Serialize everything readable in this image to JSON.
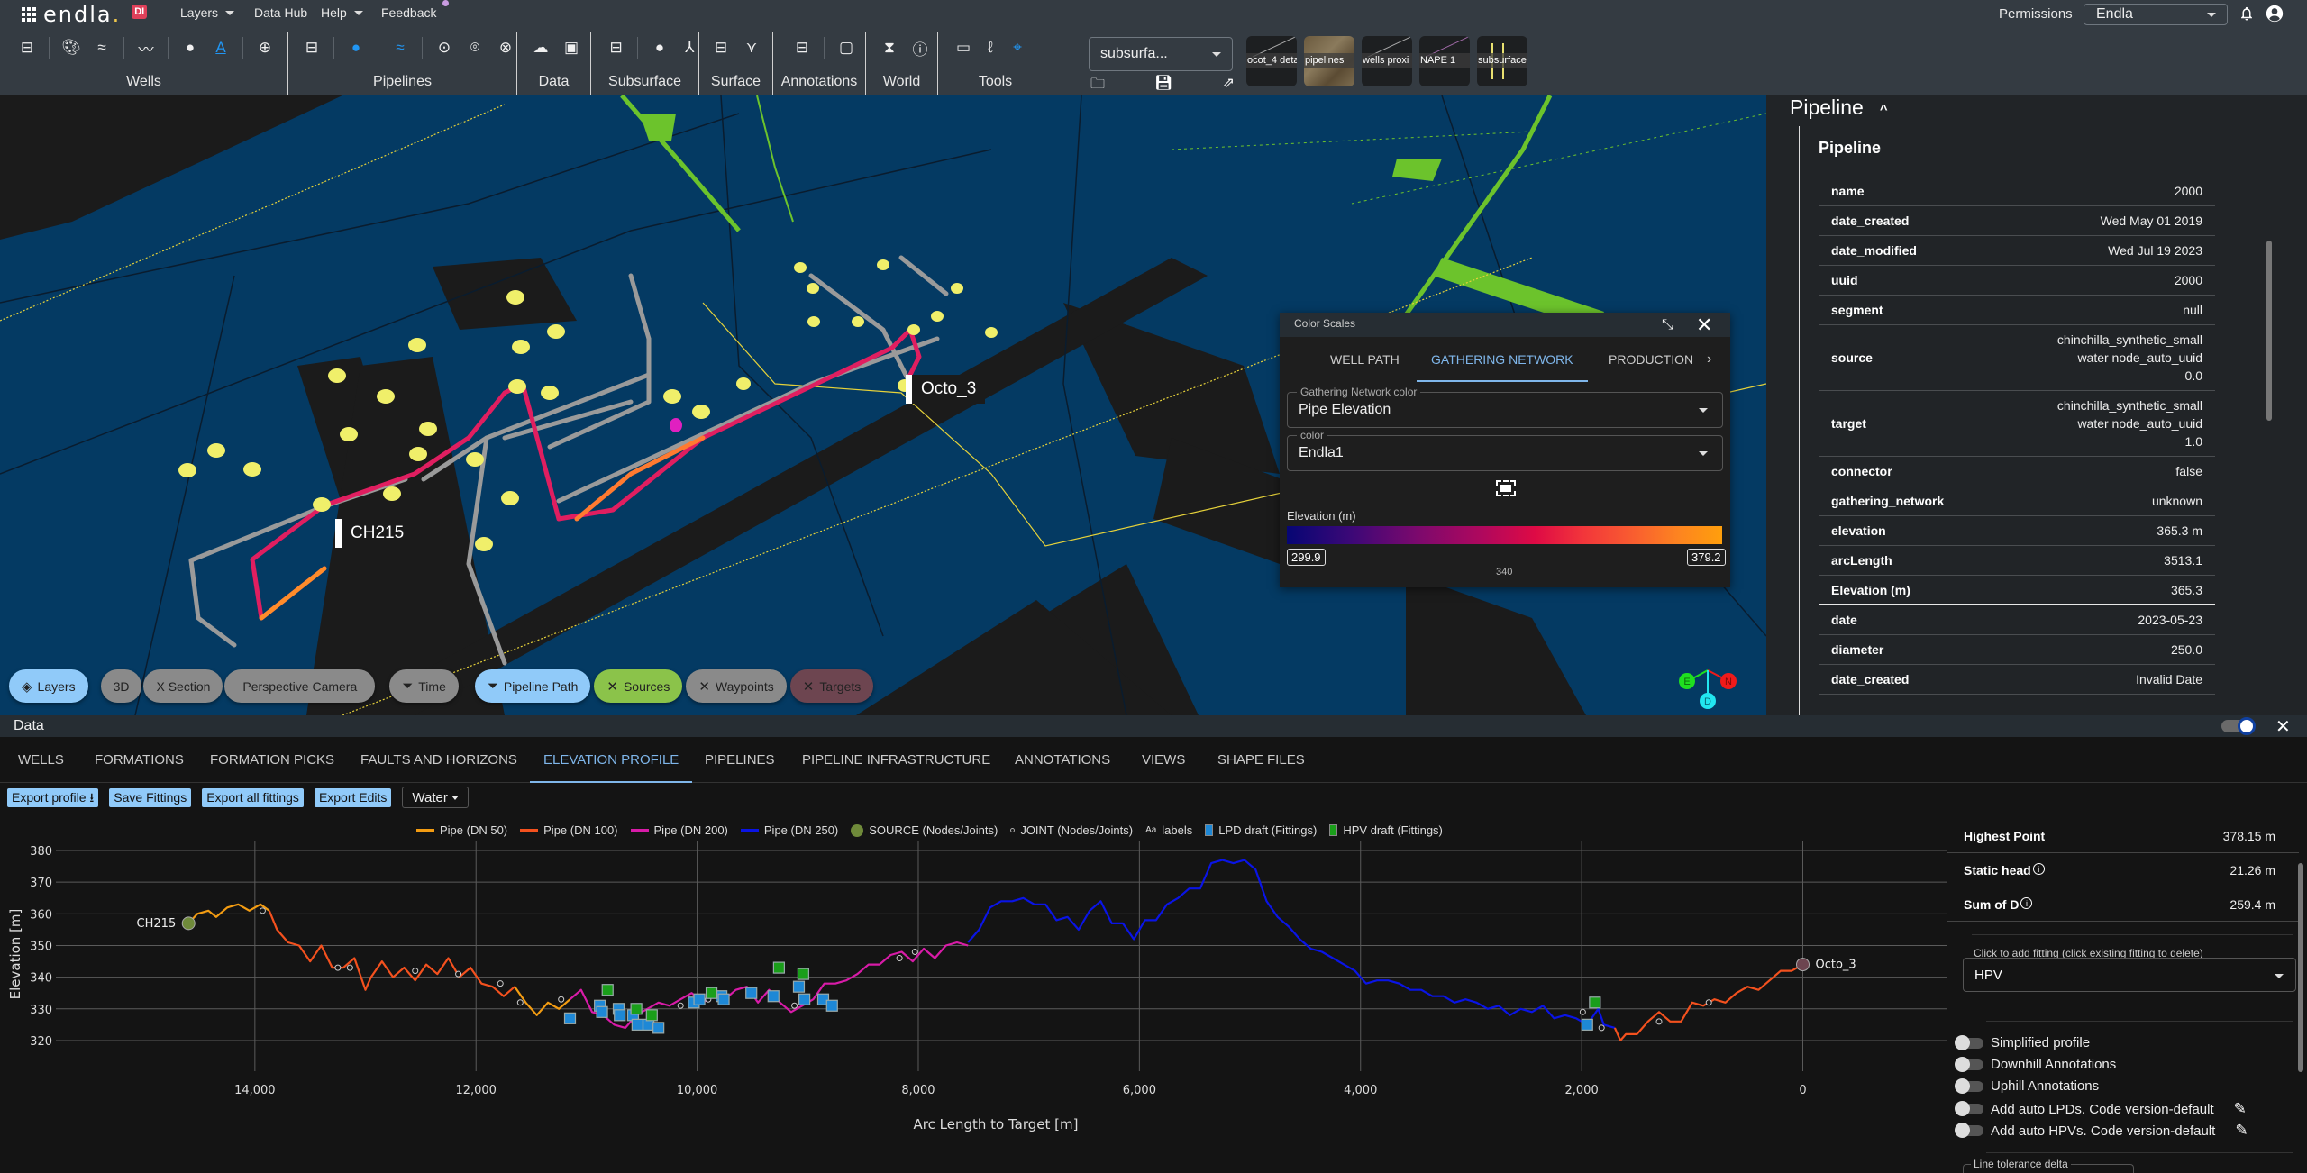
{
  "app": {
    "brand": "endla",
    "brand_dot": ".",
    "badge": "DI",
    "menu": [
      {
        "label": "Layers",
        "has_caret": true
      },
      {
        "label": "Data Hub",
        "has_caret": false
      },
      {
        "label": "Help",
        "has_caret": true
      },
      {
        "label": "Feedback",
        "has_caret": false
      }
    ],
    "permissions_label": "Permissions",
    "org_select": "Endla",
    "icons": {
      "notifications": "bell-icon",
      "account": "account-circle-icon",
      "apps": "apps-grid-icon"
    }
  },
  "toolbar": {
    "groups": [
      {
        "label": "Wells",
        "icons": [
          "layout-panel-icon",
          "palette-icon",
          "double-chevron-icon",
          "trend-line-icon",
          "bubbles-icon",
          "text-color-icon",
          "add-circle-icon"
        ]
      },
      {
        "label": "Pipelines",
        "icons": [
          "layout-panel-icon",
          "palette-icon",
          "double-chevron-icon",
          "target-icon",
          "add-location-icon",
          "cancel-circle-icon"
        ]
      },
      {
        "label": "Data",
        "icons": [
          "cloud-upload-icon",
          "database-icon"
        ]
      },
      {
        "label": "Subsurface",
        "icons": [
          "layout-panel-icon",
          "palette-icon",
          "fork-icon"
        ]
      },
      {
        "label": "Surface",
        "icons": [
          "layout-panel-icon",
          "grass-icon"
        ]
      },
      {
        "label": "Annotations",
        "icons": [
          "layout-panel-icon",
          "comment-icon"
        ]
      },
      {
        "label": "World",
        "icons": [
          "hourglass-icon",
          "info-icon"
        ]
      },
      {
        "label": "Tools",
        "icons": [
          "ruler-icon",
          "lasso-icon",
          "crosshair-icon"
        ]
      }
    ],
    "view_select": "subsurfa...",
    "view_actions": [
      "folder-icon",
      "save-icon",
      "share-icon"
    ],
    "saved_views": [
      "ocot_4 deta",
      "pipelines",
      "wells proxi",
      "NAPE 1",
      "subsurface"
    ]
  },
  "viewport": {
    "labels": [
      {
        "text": "CH215",
        "color": "#8bc34a"
      },
      {
        "text": "Octo_3",
        "color": "#6d4550"
      }
    ],
    "chips": [
      {
        "label": "Layers",
        "icon": "layers-icon",
        "style": "blue"
      },
      {
        "label": "3D",
        "icon": "",
        "style": "grey"
      },
      {
        "label": "X Section",
        "icon": "",
        "style": "grey"
      },
      {
        "label": "Perspective Camera",
        "icon": "",
        "style": "grey"
      },
      {
        "label": "Time",
        "icon": "filter-icon",
        "style": "grey"
      },
      {
        "label": "Pipeline Path",
        "icon": "filter-icon",
        "style": "blue"
      },
      {
        "label": "Sources",
        "icon": "close-icon",
        "style": "green"
      },
      {
        "label": "Waypoints",
        "icon": "close-icon",
        "style": "grey"
      },
      {
        "label": "Targets",
        "icon": "close-icon",
        "style": "red"
      }
    ],
    "compass": {
      "east": "E",
      "north": "N",
      "down": "D"
    }
  },
  "color_scales": {
    "title": "Color Scales",
    "tabs": [
      "WELL PATH",
      "GATHERING NETWORK",
      "PRODUCTION"
    ],
    "active_tab": 1,
    "network_color_label": "Gathering Network color",
    "network_color_value": "Pipe Elevation",
    "color_label": "color",
    "color_value": "Endla1",
    "legend_title": "Elevation (m)",
    "min": "299.9",
    "max": "379.2",
    "mid_tick": "340"
  },
  "properties": {
    "section_title": "Pipeline",
    "sub_title": "Pipeline",
    "rows": [
      {
        "key": "name",
        "value": [
          "2000"
        ]
      },
      {
        "key": "date_created",
        "value": [
          "Wed May 01 2019"
        ]
      },
      {
        "key": "date_modified",
        "value": [
          "Wed Jul 19 2023"
        ]
      },
      {
        "key": "uuid",
        "value": [
          "2000"
        ]
      },
      {
        "key": "segment",
        "value": [
          "null"
        ]
      },
      {
        "key": "source",
        "value": [
          "chinchilla_synthetic_small",
          "water node_auto_uuid",
          "0.0"
        ]
      },
      {
        "key": "target",
        "value": [
          "chinchilla_synthetic_small",
          "water node_auto_uuid",
          "1.0"
        ]
      },
      {
        "key": "connector",
        "value": [
          "false"
        ]
      },
      {
        "key": "gathering_network",
        "value": [
          "unknown"
        ]
      },
      {
        "key": "elevation",
        "value": [
          "365.3 m"
        ]
      },
      {
        "key": "arcLength",
        "value": [
          "3513.1"
        ]
      },
      {
        "key": "Elevation (m)",
        "value": [
          "365.3"
        ]
      },
      {
        "key": "date",
        "value": [
          "2023-05-23"
        ]
      },
      {
        "key": "diameter",
        "value": [
          "250.0"
        ]
      },
      {
        "key": "date_created",
        "value": [
          "Invalid Date"
        ]
      }
    ]
  },
  "data_panel": {
    "title": "Data",
    "tabs": [
      "WELLS",
      "FORMATIONS",
      "FORMATION PICKS",
      "FAULTS AND HORIZONS",
      "ELEVATION PROFILE",
      "PIPELINES",
      "PIPELINE INFRASTRUCTURE",
      "ANNOTATIONS",
      "VIEWS",
      "SHAPE FILES"
    ],
    "active_tab": 4,
    "buttons": {
      "export_profile": "Export profile",
      "save_fittings": "Save Fittings",
      "export_all": "Export all fittings",
      "export_edits": "Export Edits"
    },
    "fluid_select": "Water",
    "legend": [
      {
        "label": "Pipe (DN 50)",
        "type": "line",
        "color": "#f39c12"
      },
      {
        "label": "Pipe (DN 100)",
        "type": "line",
        "color": "#f4511e"
      },
      {
        "label": "Pipe (DN 200)",
        "type": "line",
        "color": "#d81ba8"
      },
      {
        "label": "Pipe (DN 250)",
        "type": "line",
        "color": "#0a14e6"
      },
      {
        "label": "SOURCE (Nodes/Joints)",
        "type": "circle",
        "color": "#6f8a3a"
      },
      {
        "label": "JOINT (Nodes/Joints)",
        "type": "small-circle",
        "color": "#aaaaaa"
      },
      {
        "label": "labels",
        "type": "text",
        "color": "#dddddd"
      },
      {
        "label": "LPD draft (Fittings)",
        "type": "square",
        "color": "#1e88d6"
      },
      {
        "label": "HPV draft (Fittings)",
        "type": "square",
        "color": "#1a9e1a"
      }
    ],
    "stats": [
      {
        "key": "Highest Point",
        "value": "378.15 m",
        "info": false
      },
      {
        "key": "Static head",
        "value": "21.26 m",
        "info": true
      },
      {
        "key": "Sum of D",
        "value": "259.4 m",
        "info": true
      }
    ],
    "fitting_hint": "Click to add fitting (click existing fitting to delete)",
    "fitting_select": "HPV",
    "toggles": [
      {
        "label": "Simplified profile",
        "on": false,
        "editable": false
      },
      {
        "label": "Downhill Annotations",
        "on": false,
        "editable": false
      },
      {
        "label": "Uphill Annotations",
        "on": false,
        "editable": false
      },
      {
        "label": "Add auto LPDs. Code version-default",
        "on": false,
        "editable": true
      },
      {
        "label": "Add auto HPVs. Code version-default",
        "on": false,
        "editable": true
      }
    ],
    "line_tolerance_label": "Line tolerance delta"
  },
  "chart_data": {
    "type": "line",
    "title": "",
    "xlabel": "Arc Length to Target [m]",
    "ylabel": "Elevation [m]",
    "xlim": [
      15800,
      -1300
    ],
    "x_reversed": true,
    "ylim": [
      316,
      382
    ],
    "xticks": [
      14000,
      12000,
      10000,
      8000,
      6000,
      4000,
      2000,
      0
    ],
    "xtick_labels": [
      "14,000",
      "12,000",
      "10,000",
      "8,000",
      "6,000",
      "4,000",
      "2,000",
      "0"
    ],
    "yticks": [
      320,
      330,
      340,
      350,
      360,
      370,
      380
    ],
    "grid": true,
    "series": [
      {
        "name": "Pipe (DN 50)",
        "color": "#f39c12",
        "x": [
          14600,
          14520,
          14420,
          14350,
          14250,
          14150,
          14050,
          13950,
          13870
        ],
        "y": [
          357,
          360,
          361,
          359,
          362,
          363,
          361,
          363,
          361
        ]
      },
      {
        "name": "Pipe (DN 100)",
        "color": "#f4511e",
        "x": [
          13870,
          13800,
          13700,
          13600,
          13500,
          13400,
          13300,
          13200,
          13100,
          13000,
          12950,
          12850,
          12750,
          12650,
          12550,
          12450,
          12350,
          12250,
          12150,
          12050,
          11950,
          11850,
          11750,
          11650
        ],
        "y": [
          361,
          355,
          351,
          350,
          345,
          350,
          343,
          343,
          346,
          336,
          340,
          345,
          340,
          343,
          339,
          344,
          341,
          346,
          340,
          343,
          338,
          337,
          334,
          337
        ]
      },
      {
        "name": "Pipe (DN 50)",
        "color": "#f39c12",
        "x": [
          11650,
          11550,
          11450,
          11350,
          11250,
          11150
        ],
        "y": [
          337,
          332,
          328,
          332,
          330,
          333
        ]
      },
      {
        "name": "Pipe (DN 200)",
        "color": "#d81ba8",
        "x": [
          11150,
          11050,
          10950,
          10850,
          10750,
          10650,
          10550,
          10450,
          10350,
          10250,
          10150,
          10050,
          9950,
          9850,
          9750,
          9650,
          9550,
          9450,
          9350,
          9250,
          9150,
          9050,
          8950,
          8850,
          8750,
          8650,
          8550,
          8450,
          8350,
          8250,
          8150,
          8050,
          7950,
          7850,
          7750,
          7650,
          7550
        ],
        "y": [
          333,
          336,
          329,
          328,
          325,
          324,
          328,
          330,
          332,
          331,
          333,
          335,
          332,
          334,
          333,
          336,
          337,
          332,
          336,
          332,
          329,
          331,
          333,
          338,
          338,
          339,
          341,
          344,
          344,
          347,
          348,
          345,
          349,
          346,
          350,
          351,
          350
        ]
      },
      {
        "name": "Pipe (DN 250)",
        "color": "#0a14e6",
        "x": [
          7550,
          7450,
          7350,
          7250,
          7150,
          7050,
          6950,
          6850,
          6750,
          6650,
          6550,
          6450,
          6350,
          6250,
          6150,
          6050,
          5950,
          5850,
          5750,
          5650,
          5550,
          5450,
          5350,
          5250,
          5150,
          5050,
          4950,
          4850,
          4750,
          4650,
          4550,
          4450,
          4350,
          4250,
          4150,
          4050,
          3950,
          3850,
          3750,
          3650,
          3550,
          3450,
          3350,
          3250,
          3150,
          3050,
          2950,
          2850,
          2750,
          2650,
          2550,
          2450,
          2350,
          2250,
          2150,
          2050,
          1950,
          1850,
          1800,
          1700
        ],
        "y": [
          351,
          355,
          362,
          364,
          364,
          365,
          363,
          363,
          358,
          359,
          355,
          361,
          364,
          357,
          357,
          352,
          358,
          358,
          363,
          365,
          368,
          368,
          376,
          377,
          376,
          377,
          374,
          364,
          359,
          356,
          352,
          349,
          348,
          346,
          344,
          342,
          338,
          339,
          339,
          338,
          336,
          336,
          334,
          334,
          332,
          333,
          332,
          330,
          331,
          328,
          330,
          329,
          331,
          327,
          328,
          327,
          325,
          330,
          325,
          324
        ]
      },
      {
        "name": "Pipe (DN 100)",
        "color": "#f4511e",
        "x": [
          1700,
          1650,
          1600,
          1500,
          1400,
          1300,
          1200,
          1100,
          1000,
          900,
          800,
          700,
          600,
          500,
          400,
          300,
          200,
          100,
          0
        ],
        "y": [
          324,
          320,
          322,
          322,
          326,
          329,
          326,
          326,
          332,
          331,
          333,
          332,
          335,
          337,
          336,
          339,
          342,
          342,
          344
        ]
      }
    ],
    "sources": [
      {
        "label": "CH215",
        "x": 14600,
        "y": 357,
        "color": "#6f8a3a"
      },
      {
        "label": "Octo_3",
        "x": 0,
        "y": 344,
        "color": "#6d4550"
      }
    ],
    "joints": [
      {
        "x": 13930,
        "y": 361
      },
      {
        "x": 13250,
        "y": 343
      },
      {
        "x": 13140,
        "y": 343
      },
      {
        "x": 12550,
        "y": 342
      },
      {
        "x": 12160,
        "y": 341
      },
      {
        "x": 11780,
        "y": 338
      },
      {
        "x": 11600,
        "y": 332
      },
      {
        "x": 11230,
        "y": 333
      },
      {
        "x": 10150,
        "y": 331
      },
      {
        "x": 9900,
        "y": 333
      },
      {
        "x": 9120,
        "y": 331
      },
      {
        "x": 8170,
        "y": 346
      },
      {
        "x": 8030,
        "y": 348
      },
      {
        "x": 1990,
        "y": 329
      },
      {
        "x": 1820,
        "y": 324
      },
      {
        "x": 1300,
        "y": 326
      },
      {
        "x": 850,
        "y": 332
      }
    ],
    "lpd_fittings": [
      {
        "x": 11150,
        "y": 327
      },
      {
        "x": 10880,
        "y": 331
      },
      {
        "x": 10860,
        "y": 329
      },
      {
        "x": 10710,
        "y": 330
      },
      {
        "x": 10700,
        "y": 328
      },
      {
        "x": 10580,
        "y": 328
      },
      {
        "x": 10540,
        "y": 325
      },
      {
        "x": 10440,
        "y": 325
      },
      {
        "x": 10350,
        "y": 324
      },
      {
        "x": 10030,
        "y": 332
      },
      {
        "x": 9980,
        "y": 333
      },
      {
        "x": 9780,
        "y": 334
      },
      {
        "x": 9760,
        "y": 333
      },
      {
        "x": 9510,
        "y": 335
      },
      {
        "x": 9310,
        "y": 334
      },
      {
        "x": 9080,
        "y": 337
      },
      {
        "x": 9030,
        "y": 333
      },
      {
        "x": 8860,
        "y": 333
      },
      {
        "x": 8780,
        "y": 331
      },
      {
        "x": 1950,
        "y": 325
      }
    ],
    "hpv_fittings": [
      {
        "x": 10810,
        "y": 336
      },
      {
        "x": 10550,
        "y": 330
      },
      {
        "x": 10410,
        "y": 328
      },
      {
        "x": 9870,
        "y": 335
      },
      {
        "x": 9260,
        "y": 343
      },
      {
        "x": 9040,
        "y": 341
      },
      {
        "x": 1880,
        "y": 332
      }
    ]
  }
}
